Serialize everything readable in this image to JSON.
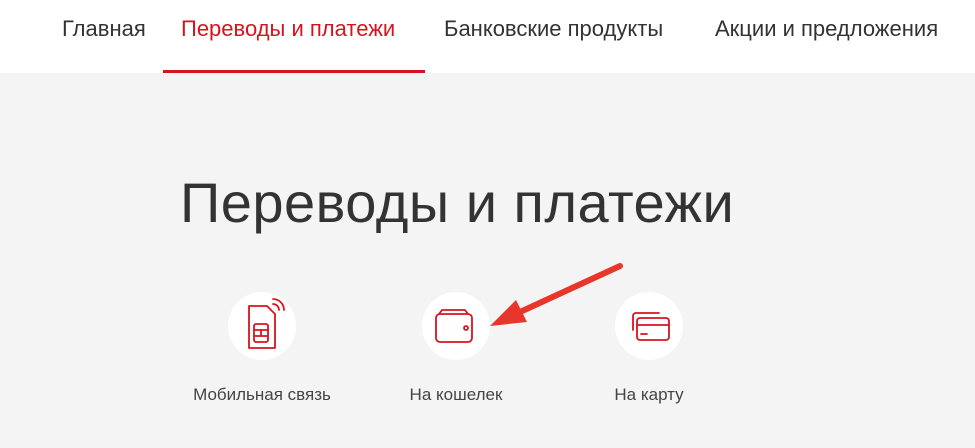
{
  "nav": {
    "items": [
      {
        "label": "Главная"
      },
      {
        "label": "Переводы и платежи"
      },
      {
        "label": "Банковские продукты"
      },
      {
        "label": "Акции и предложения"
      }
    ]
  },
  "page": {
    "title": "Переводы и платежи"
  },
  "services": [
    {
      "label": "Мобильная связь",
      "icon": "sim-card-icon"
    },
    {
      "label": "На кошелек",
      "icon": "wallet-icon"
    },
    {
      "label": "На карту",
      "icon": "cards-icon"
    }
  ],
  "colors": {
    "accent": "#d6141e",
    "text": "#333333",
    "background": "#f4f4f4",
    "annotation_arrow": "#e8362b"
  }
}
